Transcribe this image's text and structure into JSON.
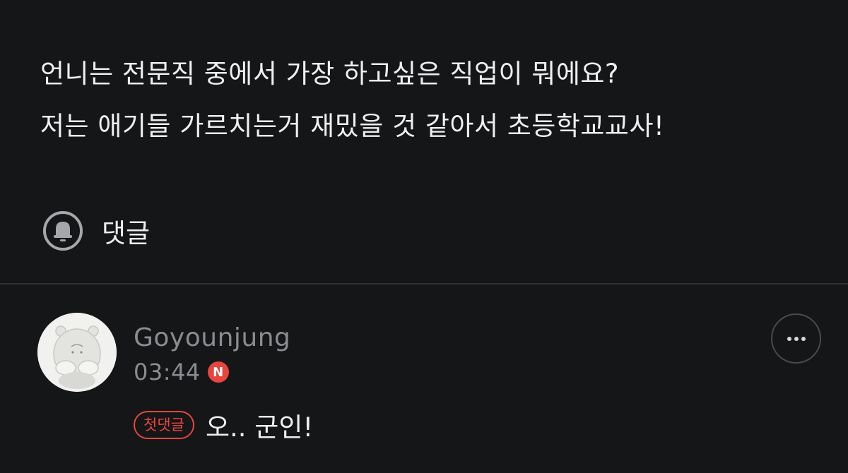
{
  "post": {
    "lines": [
      "언니는 전문직 중에서 가장 하고싶은 직업이 뭐에요?",
      "저는 애기들 가르치는거 재밌을 것 같아서 초등학교교사!"
    ]
  },
  "comment_bar": {
    "icon": "comment-bubble-icon",
    "label": "댓글"
  },
  "comment": {
    "author": "Goyounjung",
    "time": "03:44",
    "new_badge": "N",
    "first_badge": "첫댓글",
    "text": "오.. 군인!",
    "more_icon": "more-dots-icon"
  },
  "colors": {
    "background": "#151618",
    "accent_red": "#e8453c",
    "muted_text": "#8b8c90"
  }
}
